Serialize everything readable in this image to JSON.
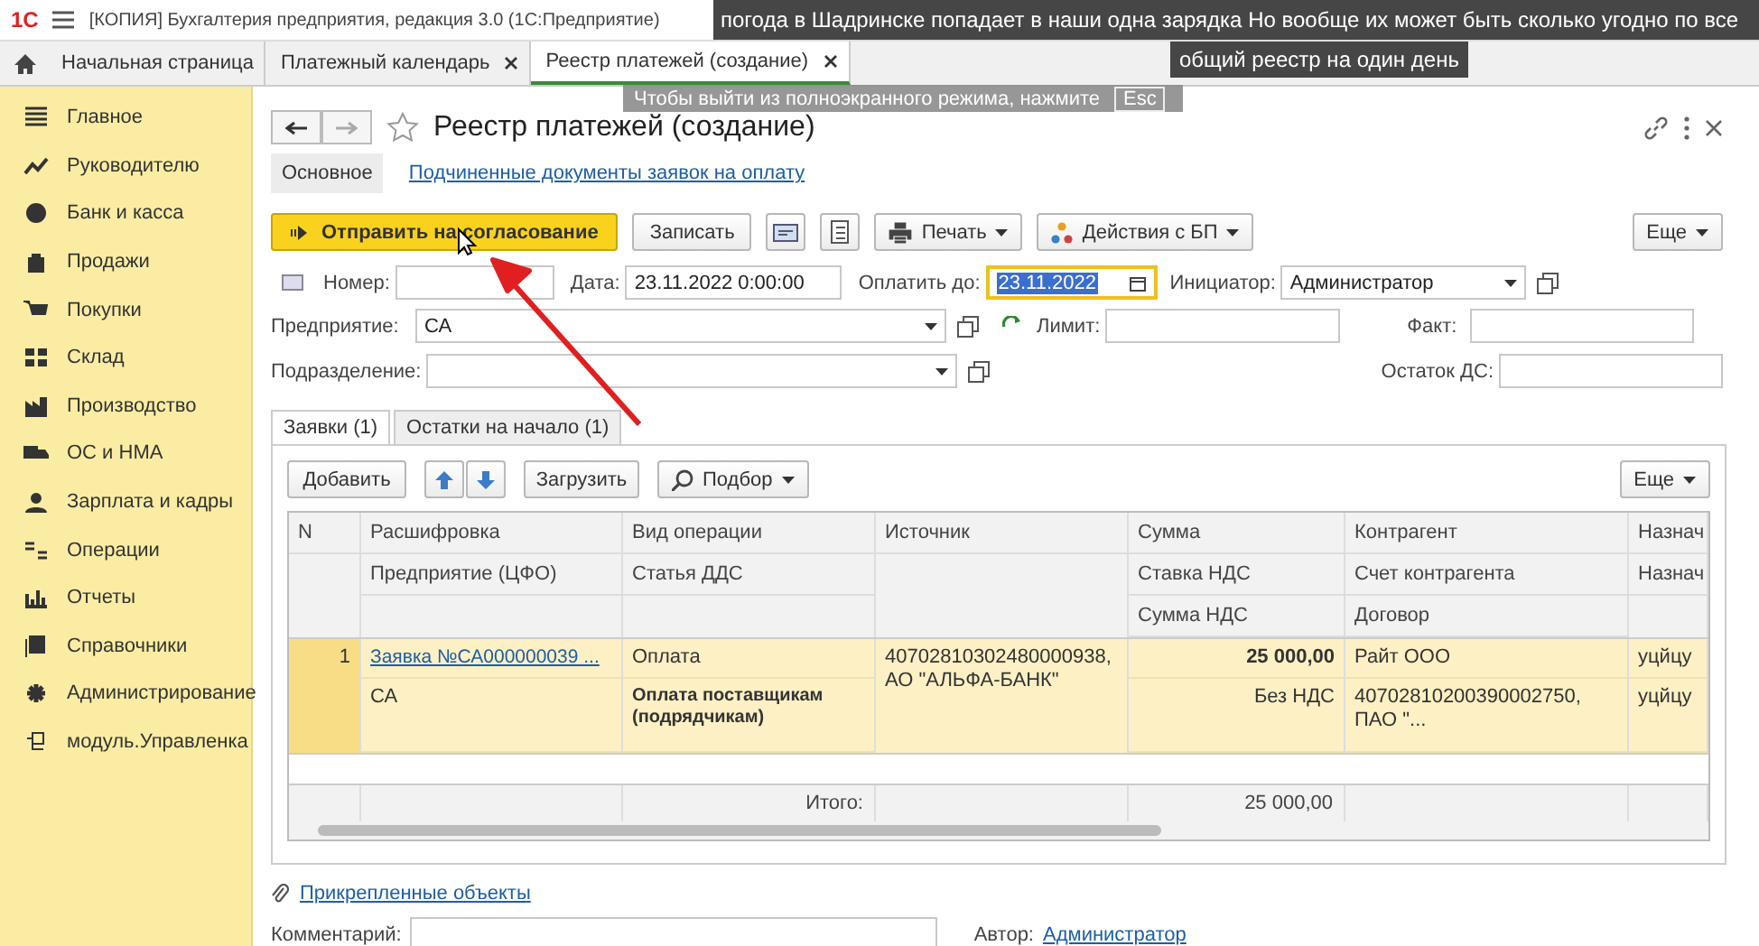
{
  "app_header": {
    "logo": "1С",
    "title": "[КОПИЯ] Бухгалтерия предприятия, редакция 3.0  (1С:Предприятие)"
  },
  "captions": [
    "погода в Шадринске попадает в наши одна зарядка Но вообще их может быть сколько угодно по все",
    "общий реестр на один день"
  ],
  "fullscreen_hint": {
    "text": "Чтобы выйти из полноэкранного режима, нажмите",
    "key": "Esc"
  },
  "tabs": [
    {
      "label": "Начальная страница",
      "selected": false,
      "closable": false
    },
    {
      "label": "Платежный календарь",
      "selected": false,
      "closable": true
    },
    {
      "label": "Реестр платежей (создание)",
      "selected": true,
      "closable": true
    }
  ],
  "sidebar": {
    "items": [
      "Главное",
      "Руководителю",
      "Банк и касса",
      "Продажи",
      "Покупки",
      "Склад",
      "Производство",
      "ОС и НМА",
      "Зарплата и кадры",
      "Операции",
      "Отчеты",
      "Справочники",
      "Администрирование",
      "модуль.Управленка"
    ]
  },
  "form": {
    "title": "Реестр платежей (создание)",
    "sections": [
      {
        "label": "Основное",
        "selected": true
      },
      {
        "label": "Подчиненные документы заявок на оплату",
        "selected": false
      }
    ],
    "toolbar": {
      "primary": "Отправить на согласование",
      "save": "Записать",
      "print": "Печать",
      "actions": "Действия с БП",
      "more": "Еще"
    },
    "fields": {
      "number": {
        "label": "Номер:"
      },
      "date": {
        "label": "Дата:",
        "value": "23.11.2022  0:00:00"
      },
      "pay_until": {
        "label": "Оплатить до:",
        "value": "23.11.2022"
      },
      "initiator": {
        "label": "Инициатор:",
        "value": "Администратор"
      },
      "company": {
        "label": "Предприятие:",
        "value": "СА"
      },
      "department": {
        "label": "Подразделение:"
      },
      "limit": {
        "label": "Лимит:"
      },
      "fact": {
        "label": "Факт:"
      },
      "cash_balance": {
        "label": "Остаток ДС:"
      }
    },
    "panel_tabs": [
      {
        "label": "Заявки (1)",
        "selected": true
      },
      {
        "label": "Остатки на начало (1)",
        "selected": false
      }
    ],
    "table_toolbar": {
      "add": "Добавить",
      "load": "Загрузить",
      "pick": "Подбор",
      "more": "Еще"
    },
    "table": {
      "columns": [
        {
          "lines": [
            "N"
          ]
        },
        {
          "lines": [
            "Расшифровка",
            "Предприятие (ЦФО)"
          ]
        },
        {
          "lines": [
            "Вид операции",
            "Статья ДДС"
          ]
        },
        {
          "lines": [
            "Источник"
          ]
        },
        {
          "lines": [
            "Сумма",
            "Ставка НДС",
            "Сумма НДС"
          ]
        },
        {
          "lines": [
            "Контрагент",
            "Счет контрагента",
            "Договор"
          ]
        },
        {
          "lines": [
            "Назнач",
            "Назнач"
          ]
        }
      ],
      "rows": [
        {
          "selected": true,
          "cells": [
            [
              {
                "kind": "number",
                "text": "1"
              }
            ],
            [
              {
                "kind": "link",
                "text": "Заявка №СА000000039 ..."
              },
              {
                "kind": "text",
                "text": "СА"
              }
            ],
            [
              {
                "kind": "text",
                "text": "Оплата"
              },
              {
                "kind": "bold",
                "text": "Оплата поставщикам (подрядчикам)"
              }
            ],
            [
              {
                "kind": "text",
                "text": "40702810302480000938, АО \"АЛЬФА-БАНК\""
              }
            ],
            [
              {
                "kind": "bold_number",
                "text": "25 000,00"
              },
              {
                "kind": "number",
                "text": "Без НДС"
              }
            ],
            [
              {
                "kind": "text",
                "text": "Райт ООО"
              },
              {
                "kind": "text",
                "text": "40702810200390002750, ПАО \"..."
              }
            ],
            [
              {
                "kind": "text",
                "text": "уцйцу"
              },
              {
                "kind": "text",
                "text": "уцйцу"
              }
            ]
          ]
        }
      ],
      "totals": {
        "label": "Итого:",
        "sum": "25 000,00"
      }
    },
    "attachments": "Прикрепленные объекты",
    "comment": {
      "label": "Комментарий:"
    },
    "author": {
      "label": "Автор:",
      "value": "Администратор"
    }
  }
}
